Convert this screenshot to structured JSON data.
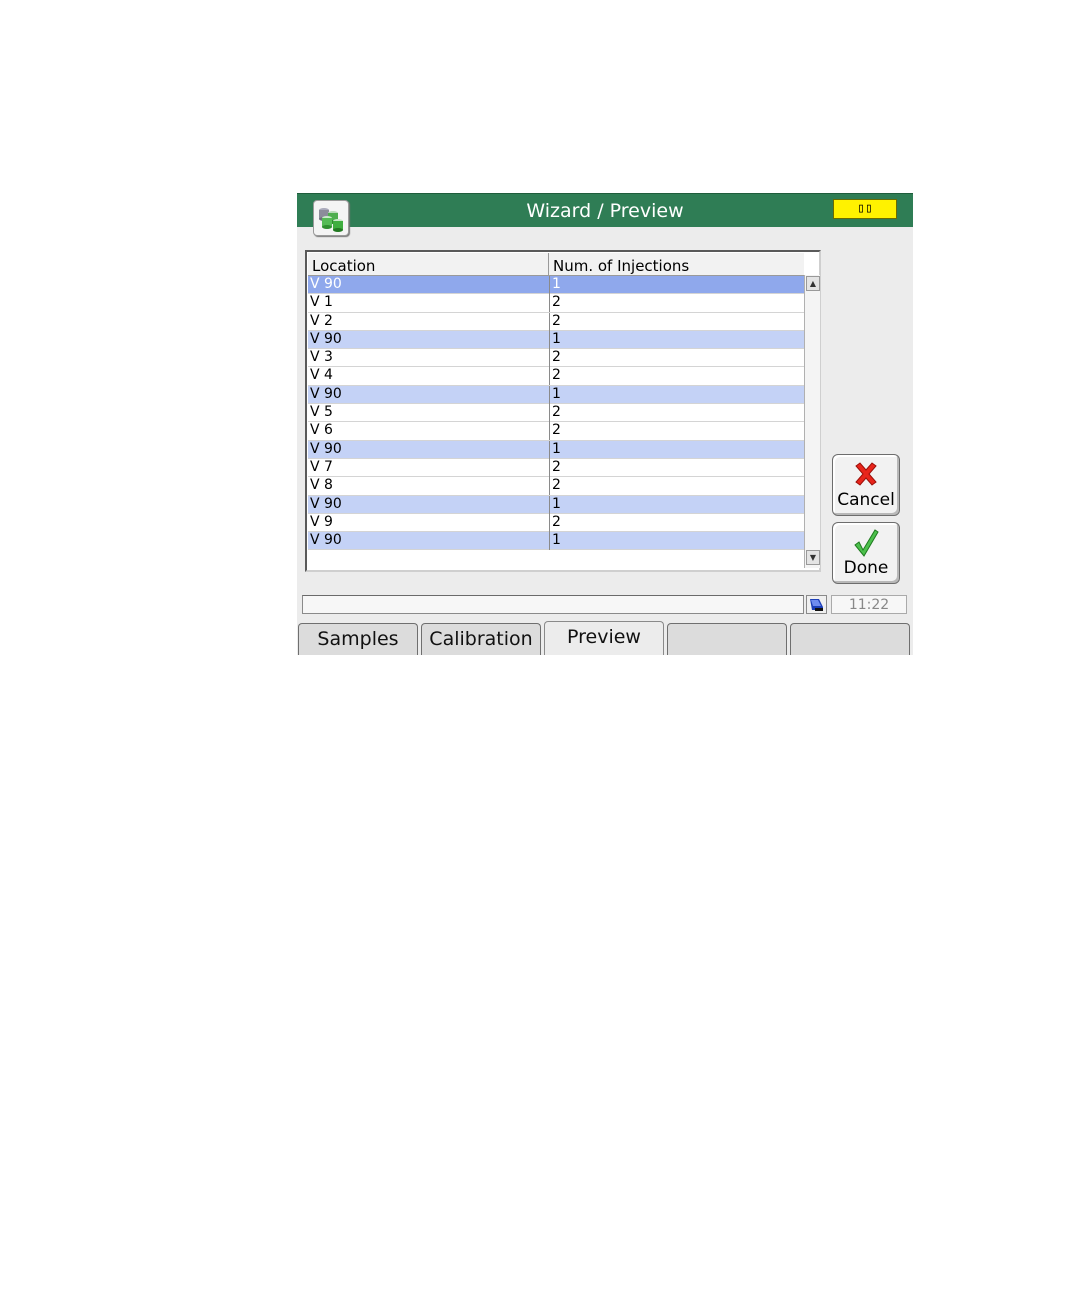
{
  "window": {
    "title": "Wizard / Preview",
    "indicator_text": "▯▯",
    "indicator_color": "#fff200",
    "titlebar_color": "#2f7d55",
    "app_icon": "sample-vials-icon"
  },
  "table": {
    "headers": [
      "Location",
      "Num. of Injections"
    ],
    "rows": [
      {
        "location": "V 90",
        "injections": "1",
        "style": "sel"
      },
      {
        "location": "V 1",
        "injections": "2",
        "style": ""
      },
      {
        "location": "V 2",
        "injections": "2",
        "style": ""
      },
      {
        "location": "V 90",
        "injections": "1",
        "style": "hl"
      },
      {
        "location": "V 3",
        "injections": "2",
        "style": ""
      },
      {
        "location": "V 4",
        "injections": "2",
        "style": ""
      },
      {
        "location": "V 90",
        "injections": "1",
        "style": "hl"
      },
      {
        "location": "V 5",
        "injections": "2",
        "style": ""
      },
      {
        "location": "V 6",
        "injections": "2",
        "style": ""
      },
      {
        "location": "V 90",
        "injections": "1",
        "style": "hl"
      },
      {
        "location": "V 7",
        "injections": "2",
        "style": ""
      },
      {
        "location": "V 8",
        "injections": "2",
        "style": ""
      },
      {
        "location": "V 90",
        "injections": "1",
        "style": "hl"
      },
      {
        "location": "V 9",
        "injections": "2",
        "style": ""
      },
      {
        "location": "V 90",
        "injections": "1",
        "style": "hl"
      }
    ],
    "scroll_up_icon": "scroll-up-arrow-icon",
    "scroll_down_icon": "scroll-down-arrow-icon"
  },
  "buttons": {
    "cancel_label": "Cancel",
    "cancel_icon": "red-x-icon",
    "done_label": "Done",
    "done_icon": "green-checkmark-icon"
  },
  "statusbar": {
    "message": "",
    "network_icon": "network-status-icon",
    "clock": "11:22"
  },
  "tabs": [
    {
      "label": "Samples",
      "active": false
    },
    {
      "label": "Calibration",
      "active": false
    },
    {
      "label": "Preview",
      "active": true
    },
    {
      "label": "",
      "active": false
    },
    {
      "label": "",
      "active": false
    }
  ]
}
